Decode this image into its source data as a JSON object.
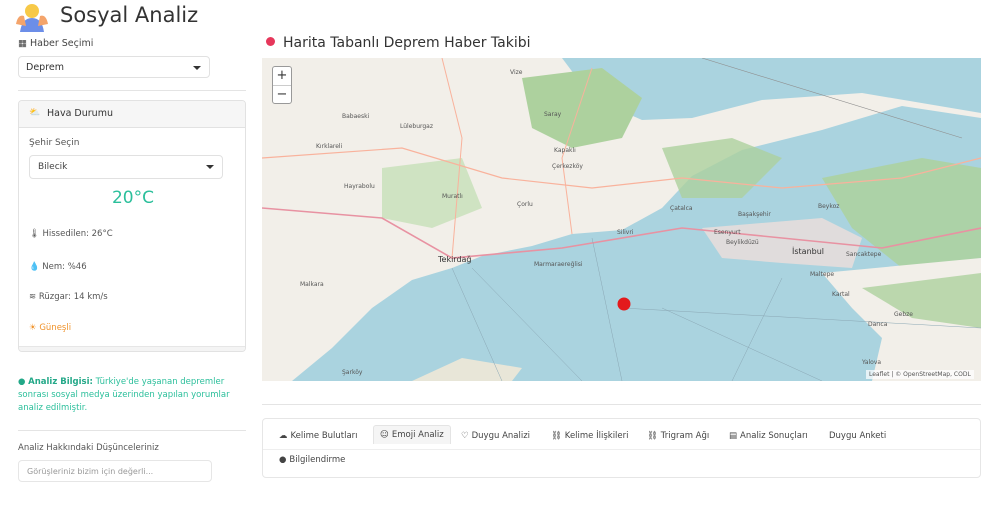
{
  "app": {
    "title": "Sosyal Analiz"
  },
  "sidebar": {
    "news_label": "Haber Seçimi",
    "news_value": "Deprem",
    "weather": {
      "header": "Hava Durumu",
      "city_label": "Şehir Seçin",
      "city_value": "Bilecik",
      "temperature": "20°C",
      "feels_like": "Hissedilen: 26°C",
      "humidity": "Nem: %46",
      "wind": "Rüzgar: 14 km/s",
      "condition": "Güneşli"
    },
    "info": {
      "title": "Analiz Bilgisi:",
      "text": "Türkiye'de yaşanan depremler sonrası sosyal medya üzerinden yapılan yorumlar analiz edilmiştir."
    },
    "thoughts_label": "Analiz Hakkındaki Düşünceleriniz",
    "thoughts_placeholder": "Görüşleriniz bizim için değerli..."
  },
  "main": {
    "map_title": "Harita Tabanlı Deprem Haber Takibi",
    "map": {
      "zoom_in": "+",
      "zoom_out": "−",
      "attribution": "Leaflet | © OpenStreetMap, CODL",
      "labels": [
        "Tekirdağ",
        "İstanbul",
        "Marmaraereğlisi",
        "Çorlu",
        "Silivri",
        "Çatalca",
        "Saray",
        "Malkara",
        "Hayrabolu",
        "Muratlı",
        "Babaeski",
        "Lüleburgaz",
        "Kırklareli",
        "Vize",
        "Çerkezköy",
        "Kapaklı",
        "Gebze",
        "Darıca",
        "Yalova",
        "Beylikdüzü",
        "Esenyurt",
        "Başakşehir",
        "Kartal",
        "Şarköy",
        "Beykoz",
        "Sancaktepe",
        "Maltepe"
      ]
    },
    "tabs": [
      {
        "icon": "cloud-icon",
        "label": "Kelime Bulutları"
      },
      {
        "icon": "emoji-icon",
        "label": "Emoji Analiz"
      },
      {
        "icon": "heart-icon",
        "label": "Duygu Analizi"
      },
      {
        "icon": "network-icon",
        "label": "Kelime İlişkileri"
      },
      {
        "icon": "network-icon",
        "label": "Trigram Ağı"
      },
      {
        "icon": "chart-icon",
        "label": "Analiz Sonuçları"
      },
      {
        "icon": "",
        "label": "Duygu Anketi"
      },
      {
        "icon": "info-icon",
        "label": "Bilgilendirme"
      }
    ],
    "active_tab": "Emoji Analiz"
  },
  "colors": {
    "accent": "#2bbf9b",
    "sunny": "#f0932b",
    "marker": "#e31a1c",
    "pin": "#e6375b",
    "sea": "#aad3df",
    "land": "#f2efe9",
    "forest": "#add19e"
  }
}
